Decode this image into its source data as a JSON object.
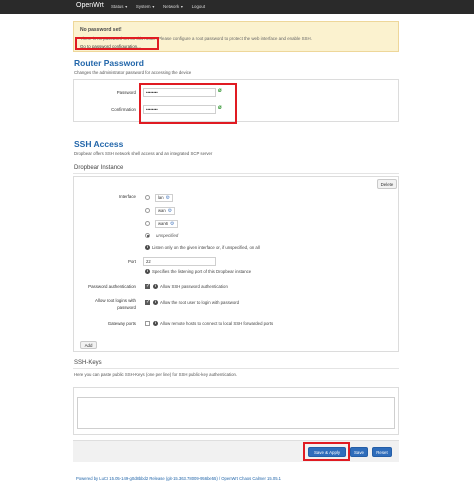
{
  "navbar": {
    "brand": "OpenWrt",
    "items": [
      {
        "label": "Status",
        "caret": "▼"
      },
      {
        "label": "System",
        "caret": "▼"
      },
      {
        "label": "Network",
        "caret": "▼"
      },
      {
        "label": "Logout",
        "caret": ""
      }
    ]
  },
  "alert": {
    "title": "No password set!",
    "text": "There is no password set on this router. Please configure a root password to protect the web interface and enable SSH.",
    "link": "Go to password configuration..."
  },
  "router_password": {
    "title": "Router Password",
    "description": "Changes the administrator password for accessing the device",
    "password_label": "Password",
    "password_value": "••••••••",
    "confirmation_label": "Confirmation",
    "confirmation_value": "••••••••",
    "reveal_icon": "ø"
  },
  "ssh_access": {
    "title": "SSH Access",
    "description": "Dropbear offers SSH network shell access and an integrated SCP server",
    "instance_title": "Dropbear Instance",
    "delete_label": "Delete",
    "interface_label": "Interface",
    "interfaces": [
      {
        "name": "lan",
        "checked": false
      },
      {
        "name": "wan",
        "checked": false
      },
      {
        "name": "wan6",
        "checked": false
      }
    ],
    "unspecified_label": "unspecified",
    "interface_hint": "Listen only on the given interface or, if unspecified, on all",
    "port_label": "Port",
    "port_value": "22",
    "port_hint": "Specifies the listening port of this Dropbear instance",
    "password_auth_label": "Password authentication",
    "password_auth_hint": "Allow SSH password authentication",
    "password_auth_checked": true,
    "root_login_label_line1": "Allow root logins with",
    "root_login_label_line2": "password",
    "root_login_hint": "Allow the root user to login with password",
    "root_login_checked": true,
    "gateway_ports_label": "Gateway ports",
    "gateway_ports_hint": "Allow remote hosts to connect to local SSH forwarded ports",
    "gateway_ports_checked": false,
    "add_label": "Add"
  },
  "ssh_keys": {
    "title": "SSH-Keys",
    "description": "Here you can paste public SSH-Keys (one per line) for SSH public-key authentication."
  },
  "actions": {
    "save_apply": "Save & Apply",
    "save": "Save",
    "reset": "Reset"
  },
  "footer": "Powered by LuCI 15.05-149-g0d8bbd2 Release (git-15.363.78009-956be55) / OpenWrt Chaos Calmer 15.05.1",
  "colors": {
    "navbar": "#2a2a2a",
    "accent": "#2266aa",
    "primary_button": "#2f6dbb",
    "highlight": "#e01b22",
    "alert_bg": "#fbf2cf"
  }
}
